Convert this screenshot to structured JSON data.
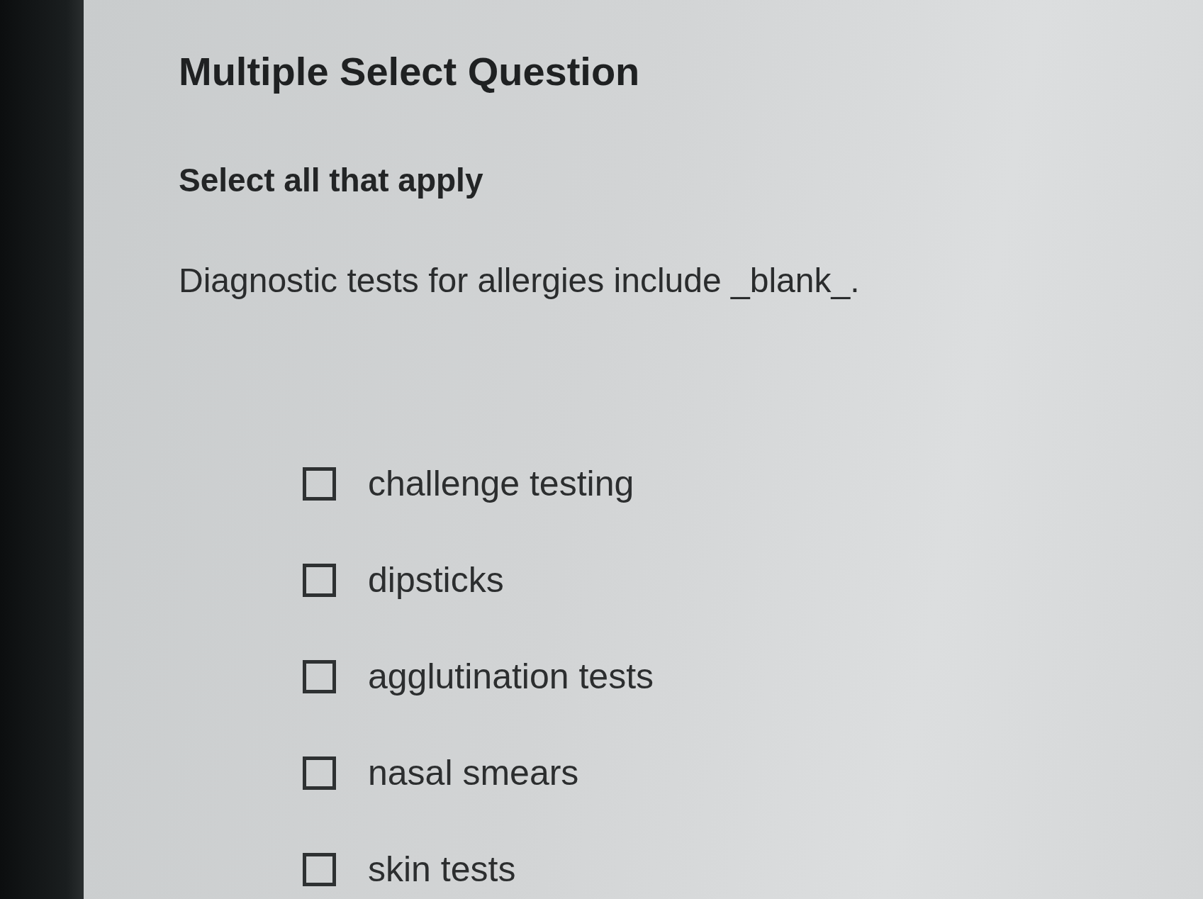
{
  "header": {
    "title": "Multiple Select Question",
    "instruction": "Select all that apply"
  },
  "question": {
    "prompt": "Diagnostic tests for allergies include _blank_."
  },
  "options": [
    {
      "label": "challenge testing",
      "checked": false
    },
    {
      "label": "dipsticks",
      "checked": false
    },
    {
      "label": "agglutination tests",
      "checked": false
    },
    {
      "label": "nasal smears",
      "checked": false
    },
    {
      "label": "skin tests",
      "checked": false
    }
  ]
}
